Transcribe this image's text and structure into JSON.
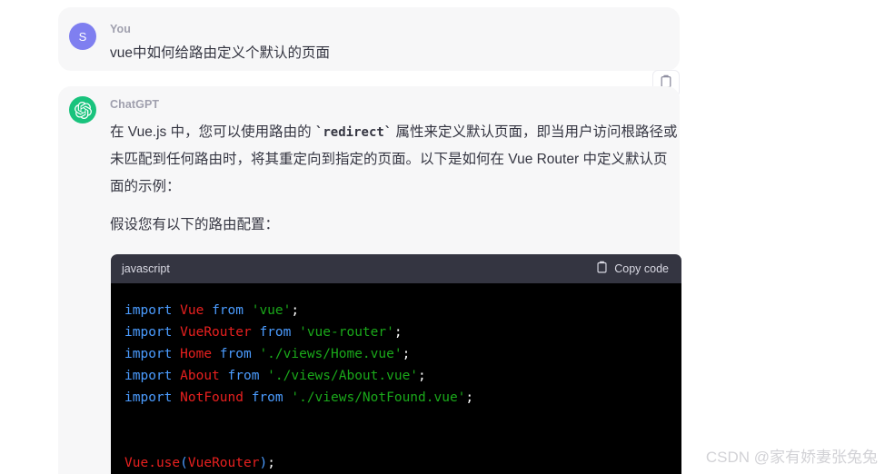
{
  "conversation": {
    "messages": [
      {
        "role_label": "You",
        "avatar_initial": "S",
        "avatar_color": "#7f7ff0",
        "text": "vue中如何给路由定义个默认的页面"
      },
      {
        "role_label": "ChatGPT",
        "avatar_icon": "openai-logo-icon",
        "avatar_color": "#19c37d",
        "paragraph_1_before_code": "在 Vue.js 中，您可以使用路由的 ",
        "paragraph_1_code": "`redirect`",
        "paragraph_1_after_code": " 属性来定义默认页面，即当用户访问根路径或未匹配到任何路由时，将其重定向到指定的页面。以下是如何在 Vue Router 中定义默认页面的示例：",
        "paragraph_2": "假设您有以下的路由配置："
      }
    ]
  },
  "message_actions": {
    "copy_message_icon": "clipboard-icon"
  },
  "code_block": {
    "language": "javascript",
    "copy_label": "Copy code",
    "copy_icon": "clipboard-icon",
    "theme": {
      "header_bg": "#343541",
      "body_bg": "#000000",
      "keyword": "#4b9cff",
      "identifier": "#e8201f",
      "string": "#1aa81a",
      "punctuation": "#ffffff"
    },
    "lines": [
      [
        {
          "t": "import",
          "c": "kw"
        },
        {
          "t": " ",
          "c": "pun"
        },
        {
          "t": "Vue",
          "c": "id"
        },
        {
          "t": " ",
          "c": "pun"
        },
        {
          "t": "from",
          "c": "kw"
        },
        {
          "t": " ",
          "c": "pun"
        },
        {
          "t": "'vue'",
          "c": "str"
        },
        {
          "t": ";",
          "c": "pun"
        }
      ],
      [
        {
          "t": "import",
          "c": "kw"
        },
        {
          "t": " ",
          "c": "pun"
        },
        {
          "t": "VueRouter",
          "c": "id"
        },
        {
          "t": " ",
          "c": "pun"
        },
        {
          "t": "from",
          "c": "kw"
        },
        {
          "t": " ",
          "c": "pun"
        },
        {
          "t": "'vue-router'",
          "c": "str"
        },
        {
          "t": ";",
          "c": "pun"
        }
      ],
      [
        {
          "t": "import",
          "c": "kw"
        },
        {
          "t": " ",
          "c": "pun"
        },
        {
          "t": "Home",
          "c": "id"
        },
        {
          "t": " ",
          "c": "pun"
        },
        {
          "t": "from",
          "c": "kw"
        },
        {
          "t": " ",
          "c": "pun"
        },
        {
          "t": "'./views/Home.vue'",
          "c": "str"
        },
        {
          "t": ";",
          "c": "pun"
        }
      ],
      [
        {
          "t": "import",
          "c": "kw"
        },
        {
          "t": " ",
          "c": "pun"
        },
        {
          "t": "About",
          "c": "id"
        },
        {
          "t": " ",
          "c": "pun"
        },
        {
          "t": "from",
          "c": "kw"
        },
        {
          "t": " ",
          "c": "pun"
        },
        {
          "t": "'./views/About.vue'",
          "c": "str"
        },
        {
          "t": ";",
          "c": "pun"
        }
      ],
      [
        {
          "t": "import",
          "c": "kw"
        },
        {
          "t": " ",
          "c": "pun"
        },
        {
          "t": "NotFound",
          "c": "id"
        },
        {
          "t": " ",
          "c": "pun"
        },
        {
          "t": "from",
          "c": "kw"
        },
        {
          "t": " ",
          "c": "pun"
        },
        {
          "t": "'./views/NotFound.vue'",
          "c": "str"
        },
        {
          "t": ";",
          "c": "pun"
        }
      ],
      [],
      [],
      [
        {
          "t": "Vue",
          "c": "id"
        },
        {
          "t": ".",
          "c": "id"
        },
        {
          "t": "use",
          "c": "id"
        },
        {
          "t": "(",
          "c": "blue"
        },
        {
          "t": "VueRouter",
          "c": "id"
        },
        {
          "t": ")",
          "c": "blue"
        },
        {
          "t": ";",
          "c": "pun"
        }
      ]
    ]
  },
  "watermark": {
    "text": "CSDN @家有娇妻张兔兔"
  }
}
